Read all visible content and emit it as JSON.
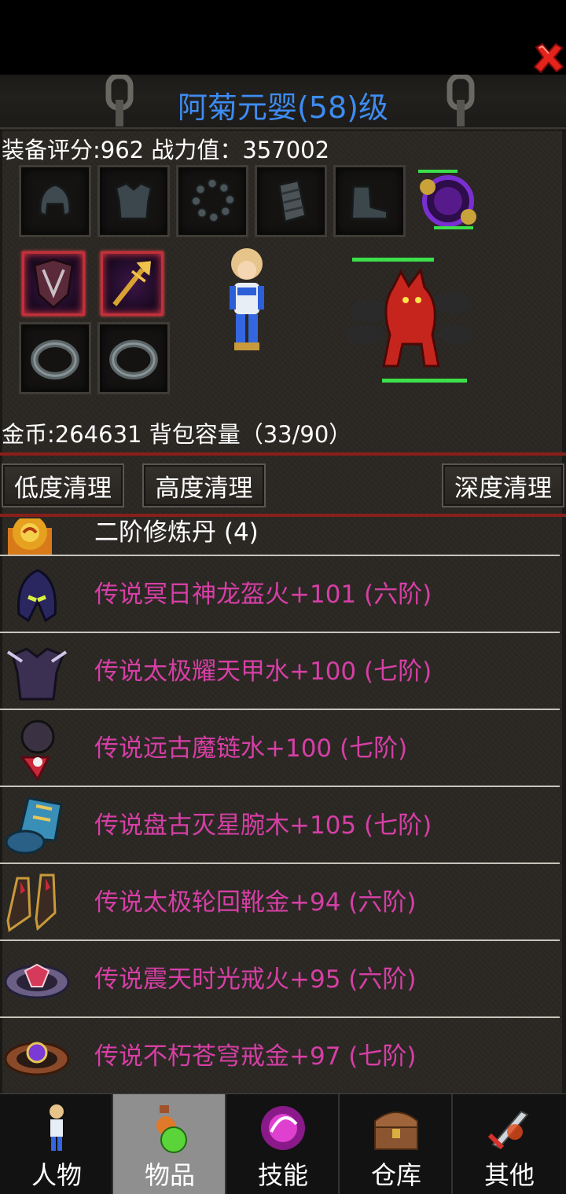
{
  "header": {
    "title": "阿菊元婴(58)级"
  },
  "stats": {
    "text": "装备评分:962 战力值：357002"
  },
  "inventory": {
    "text": "金币:264631 背包容量（33/90）"
  },
  "buttons": {
    "low_clean": "低度清理",
    "high_clean": "高度清理",
    "deep_clean": "深度清理"
  },
  "item_list": [
    {
      "name": "二阶修炼丹 (4)",
      "icon": "pill-icon"
    },
    {
      "name": "传说冥日神龙盔火+101 (六阶)",
      "icon": "helmet-icon"
    },
    {
      "name": "传说太极耀天甲水+100 (七阶)",
      "icon": "armor-icon"
    },
    {
      "name": "传说远古魔链水+100 (七阶)",
      "icon": "necklace-icon"
    },
    {
      "name": "传说盘古灭星腕木+105 (七阶)",
      "icon": "bracer-icon"
    },
    {
      "name": "传说太极轮回靴金+94 (六阶)",
      "icon": "boots-icon"
    },
    {
      "name": "传说震天时光戒火+95 (六阶)",
      "icon": "ring-icon"
    },
    {
      "name": "传说不朽苍穹戒金+97 (七阶)",
      "icon": "ring-icon"
    }
  ],
  "tabs": [
    {
      "label": "人物",
      "icon": "character-icon"
    },
    {
      "label": "物品",
      "icon": "potion-icon"
    },
    {
      "label": "技能",
      "icon": "skill-orb-icon"
    },
    {
      "label": "仓库",
      "icon": "chest-icon"
    },
    {
      "label": "其他",
      "icon": "sword-icon"
    }
  ],
  "colors": {
    "title": "#3d8cf2",
    "legendary_item": "#d63fa5",
    "panel": "#2b2824",
    "active_tab": "#8f8f8f"
  }
}
